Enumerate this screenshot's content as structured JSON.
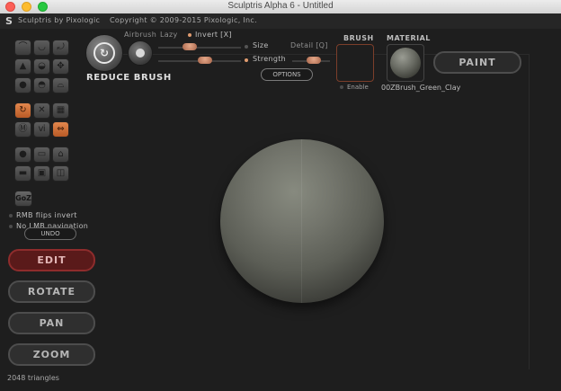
{
  "window": {
    "title": "Sculptris Alpha 6 - Untitled"
  },
  "topbar": {
    "logo_glyph": "S",
    "brand": "Sculptris by Pixologic",
    "copyright": "Copyright © 2009-2015 Pixologic, Inc."
  },
  "tools": {
    "group1": [
      "tool-draw",
      "tool-crease",
      "tool-flatten",
      "tool-inflate",
      "tool-pinch",
      "tool-grab",
      "tool-smooth",
      "tool-scale",
      "tool-rotate"
    ],
    "group2": [
      "tool-reduce-brush",
      "tool-mask",
      "tool-grid",
      "tool-subdivide",
      "tool-wave",
      "tool-symmetry"
    ],
    "group3": [
      "tool-sphere",
      "tool-plane",
      "tool-sculpt",
      "tool-cylinder",
      "tool-box",
      "tool-other"
    ],
    "goz": "GoZ"
  },
  "options": {
    "rmb_flips_invert": "RMB flips invert",
    "no_lmb_navigation": "No LMB navigation",
    "undo": "UNDO"
  },
  "modes": {
    "edit": "EDIT",
    "rotate": "ROTATE",
    "pan": "PAN",
    "zoom": "ZOOM",
    "selected": "edit"
  },
  "status": {
    "triangles": "2048 triangles"
  },
  "brush_panel": {
    "name": "REDUCE BRUSH",
    "airbrush": "Airbrush",
    "lazy": "Lazy",
    "invert": "Invert [X]",
    "size": "Size",
    "strength": "Strength",
    "detail": "Detail [Q]",
    "options": "OPTIONS",
    "brush_header": "BRUSH",
    "material_header": "MATERIAL",
    "enable": "Enable",
    "material_name": "00ZBrush_Green_Clay",
    "paint": "PAINT"
  },
  "colors": {
    "accent_orange": "#e09b6f",
    "edit_selected": "#5a1a1a"
  }
}
